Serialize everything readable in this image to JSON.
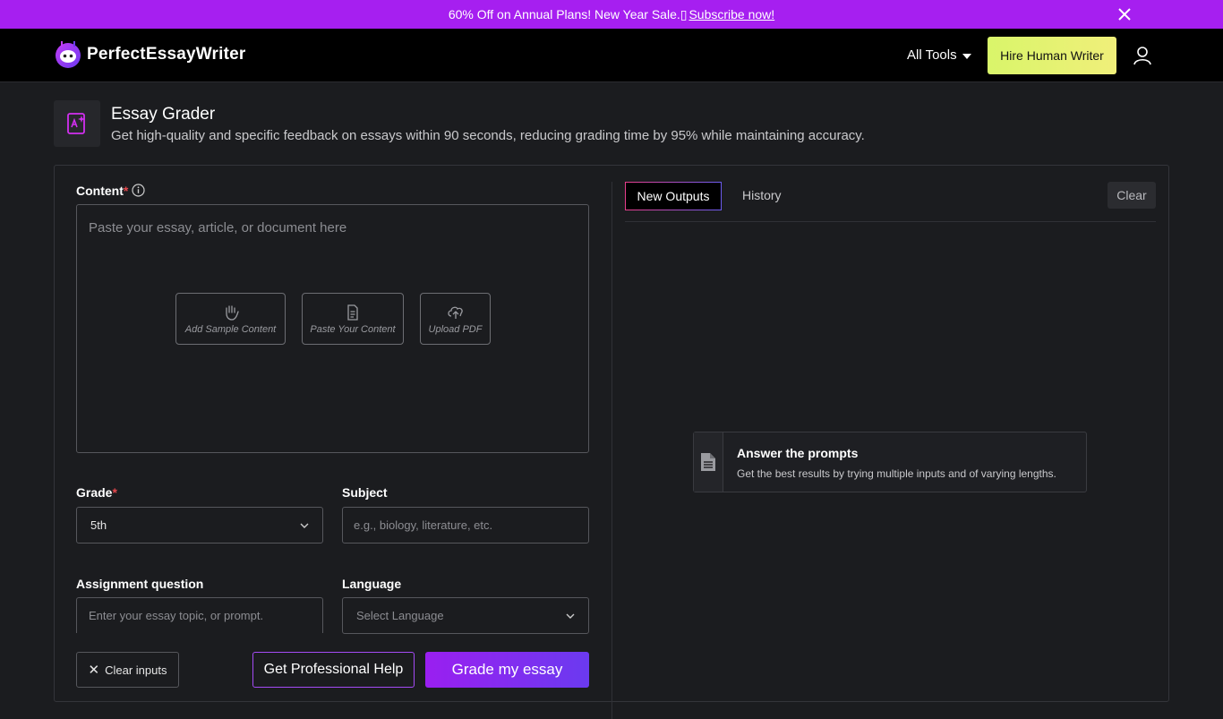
{
  "promo": {
    "text": "60% Off on Annual Plans! New Year Sale.▯",
    "link": "Subscribe now!"
  },
  "nav": {
    "brand": "PerfectEssayWriter",
    "all_tools": "All Tools",
    "hire_button": "Hire Human Writer"
  },
  "tool": {
    "title": "Essay Grader",
    "description": "Get high-quality and specific feedback on essays within 90 seconds, reducing grading time by 95% while maintaining accuracy."
  },
  "form": {
    "content_label": "Content",
    "content_required": "*",
    "content_placeholder": "Paste your essay, article, or document here",
    "actions": {
      "sample": "Add Sample Content",
      "paste": "Paste Your Content",
      "upload": "Upload PDF"
    },
    "grade_label": "Grade",
    "grade_required": "*",
    "grade_value": "5th",
    "subject_label": "Subject",
    "subject_placeholder": "e.g., biology, literature, etc.",
    "assignment_label": "Assignment question",
    "assignment_placeholder": "Enter your essay topic, or prompt.",
    "language_label": "Language",
    "language_placeholder": "Select Language",
    "clear_inputs": "Clear inputs",
    "pro_help": "Get Professional Help",
    "grade_button": "Grade my essay"
  },
  "output": {
    "tabs": [
      "New Outputs",
      "History"
    ],
    "clear": "Clear",
    "card_title": "Answer the prompts",
    "card_desc": "Get the best results by trying multiple inputs and of varying lengths."
  },
  "colors": {
    "promo_bg": "#a61ff0",
    "accent": "#9a1ff0",
    "hire_button": "#d9f56a"
  }
}
